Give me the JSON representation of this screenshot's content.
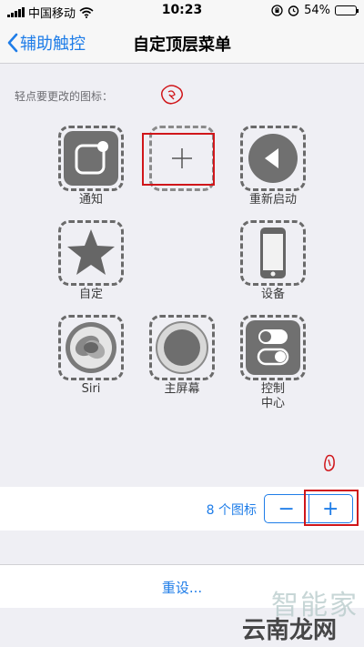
{
  "status": {
    "carrier": "中国移动",
    "time": "10:23",
    "battery": "54%"
  },
  "nav": {
    "back_label": "辅助触控",
    "title": "自定顶层菜单"
  },
  "hint": "轻点要更改的图标：",
  "slots": {
    "notify": "通知",
    "restart": "重新启动",
    "custom": "自定",
    "device": "设备",
    "siri": "Siri",
    "home": "主屏幕",
    "control_line1": "控制",
    "control_line2": "中心"
  },
  "count": {
    "label": "8 个图标",
    "minus": "−",
    "plus": "+"
  },
  "reset": "重设...",
  "watermark": {
    "line1": "智能家",
    "line2": "云南龙网"
  },
  "colors": {
    "accent": "#1f7de8",
    "annotation": "#d0161a"
  }
}
